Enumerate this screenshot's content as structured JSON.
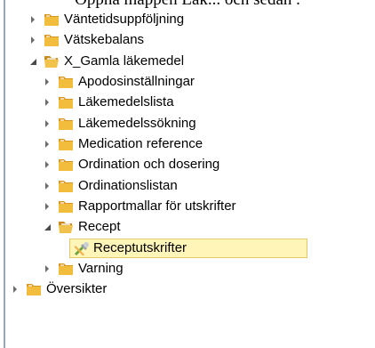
{
  "top_caption": "Öppna mappen Läk... och sedan .",
  "tree": {
    "items": [
      {
        "label": "Väntetidsuppföljning",
        "state": "collapsed",
        "icon": "folder-icon"
      },
      {
        "label": "Vätskebalans",
        "state": "collapsed",
        "icon": "folder-icon"
      },
      {
        "label": "X_Gamla läkemedel",
        "state": "expanded",
        "icon": "folder-open-icon"
      },
      {
        "label": "Apodosinställningar",
        "state": "collapsed",
        "icon": "folder-icon"
      },
      {
        "label": "Läkemedelslista",
        "state": "collapsed",
        "icon": "folder-icon"
      },
      {
        "label": "Läkemedelssökning",
        "state": "collapsed",
        "icon": "folder-icon"
      },
      {
        "label": "Medication reference",
        "state": "collapsed",
        "icon": "folder-icon"
      },
      {
        "label": "Ordination och dosering",
        "state": "collapsed",
        "icon": "folder-icon"
      },
      {
        "label": "Ordinationslistan",
        "state": "collapsed",
        "icon": "folder-icon"
      },
      {
        "label": "Rapportmallar för utskrifter",
        "state": "collapsed",
        "icon": "folder-icon"
      },
      {
        "label": "Recept",
        "state": "expanded",
        "icon": "folder-open-icon"
      },
      {
        "label": "Receptutskrifter",
        "state": "leaf",
        "icon": "tools-icon",
        "selected": true
      },
      {
        "label": "Varning",
        "state": "collapsed",
        "icon": "folder-icon"
      },
      {
        "label": "Översikter",
        "state": "collapsed",
        "icon": "folder-icon"
      }
    ]
  },
  "colors": {
    "selection_bg": "#fff5b8",
    "selection_border": "#e8c96a",
    "folder": "#e2a72e",
    "expander": "#6b6b6b"
  }
}
